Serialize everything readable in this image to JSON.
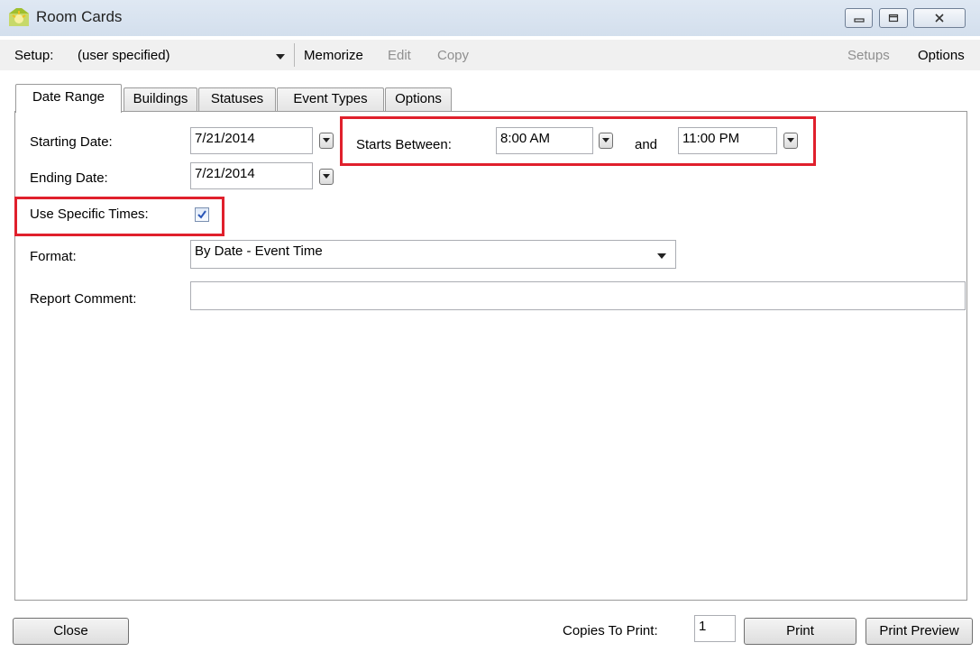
{
  "window": {
    "title": "Room Cards",
    "icons": {
      "app": "room-cards-app-icon",
      "minimize": "minimize-icon",
      "restore": "restore-icon",
      "close": "close-icon"
    }
  },
  "setup_bar": {
    "label": "Setup:",
    "selected": "(user specified)",
    "memorize": "Memorize",
    "edit": "Edit",
    "copy": "Copy",
    "setups": "Setups",
    "options": "Options"
  },
  "tabs": [
    {
      "label": "Date Range",
      "active": true
    },
    {
      "label": "Buildings",
      "active": false
    },
    {
      "label": "Statuses",
      "active": false
    },
    {
      "label": "Event Types",
      "active": false
    },
    {
      "label": "Options",
      "active": false
    }
  ],
  "form": {
    "starting_date_label": "Starting Date:",
    "starting_date": "7/21/2014",
    "ending_date_label": "Ending Date:",
    "ending_date": "7/21/2014",
    "starts_between_label": "Starts Between:",
    "start_time": "8:00 AM",
    "and_label": "and",
    "end_time": "11:00 PM",
    "use_specific_times_label": "Use Specific Times:",
    "use_specific_times_checked": true,
    "format_label": "Format:",
    "format_value": "By Date - Event Time",
    "report_comment_label": "Report Comment:",
    "report_comment_value": ""
  },
  "footer": {
    "close": "Close",
    "copies_label": "Copies To Print:",
    "copies_value": "1",
    "print": "Print",
    "print_preview": "Print Preview"
  },
  "colors": {
    "highlight": "#e0202c",
    "titlebar": "#d9e4f1"
  }
}
